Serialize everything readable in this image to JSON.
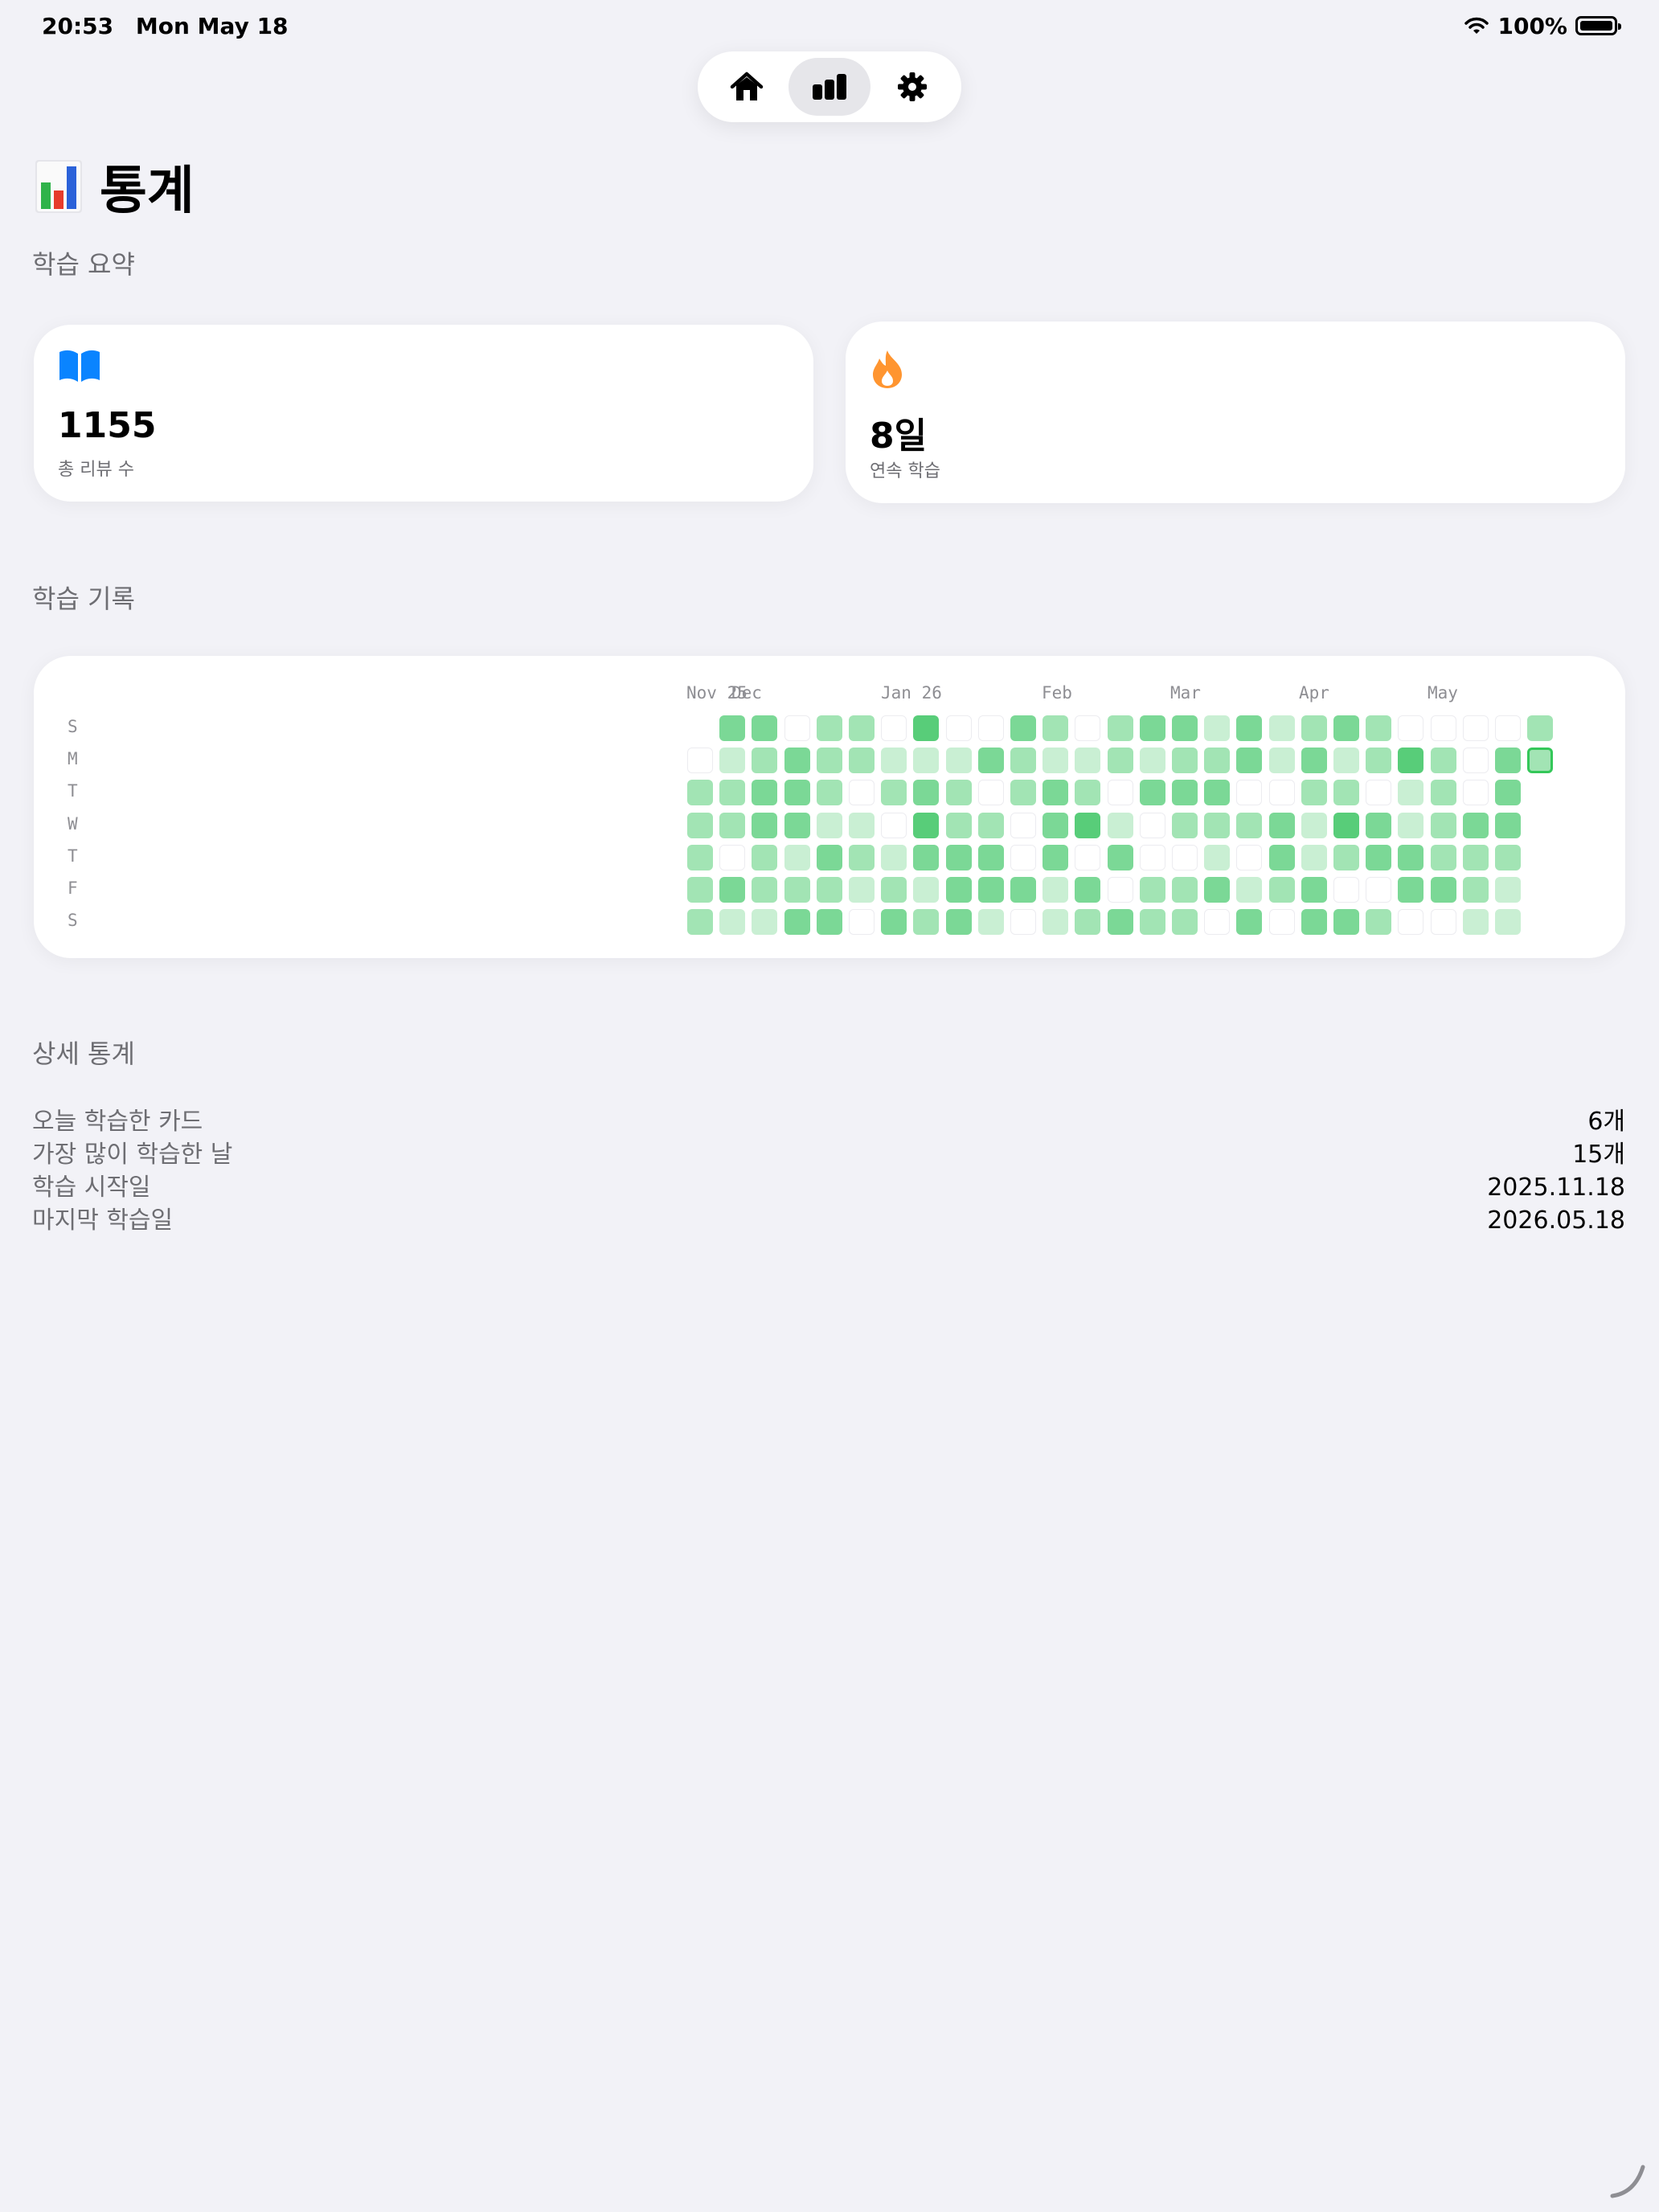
{
  "status_bar": {
    "time": "20:53",
    "date": "Mon May 18",
    "battery": "100%"
  },
  "tabs": [
    {
      "name": "home",
      "icon": "house-icon",
      "active": false
    },
    {
      "name": "stats",
      "icon": "bar-chart-icon",
      "active": true
    },
    {
      "name": "settings",
      "icon": "gear-icon",
      "active": false
    }
  ],
  "page": {
    "icon": "bar-chart-emoji",
    "title": "통계"
  },
  "summary": {
    "header": "학습 요약",
    "cards": [
      {
        "icon": "book-icon",
        "value": "1155",
        "label": "총 리뷰 수",
        "color": "#0a84ff"
      },
      {
        "icon": "flame-icon",
        "value": "8일",
        "label": "연속 학습",
        "color": "#ff9530"
      }
    ]
  },
  "history": {
    "header": "학습 기록",
    "months": [
      "Nov 25",
      "Dec",
      "Jan 26",
      "Feb",
      "Mar",
      "Apr",
      "May"
    ],
    "days": [
      "S",
      "M",
      "T",
      "W",
      "T",
      "F",
      "S"
    ],
    "level_colors": [
      "#ffffff",
      "#c9efd3",
      "#a2e4b4",
      "#7bd896",
      "#58cd79"
    ],
    "grid": [
      [
        -1,
        0,
        2,
        2,
        2,
        2,
        2
      ],
      [
        3,
        1,
        2,
        2,
        0,
        3,
        1
      ],
      [
        3,
        2,
        3,
        3,
        2,
        2,
        1
      ],
      [
        0,
        3,
        3,
        3,
        1,
        2,
        3
      ],
      [
        2,
        2,
        2,
        1,
        3,
        2,
        3
      ],
      [
        2,
        2,
        0,
        1,
        2,
        1,
        0
      ],
      [
        0,
        1,
        2,
        0,
        1,
        2,
        3
      ],
      [
        4,
        1,
        3,
        4,
        3,
        1,
        2
      ],
      [
        0,
        1,
        2,
        2,
        3,
        3,
        3
      ],
      [
        0,
        3,
        0,
        2,
        3,
        3,
        1
      ],
      [
        3,
        2,
        2,
        0,
        0,
        3,
        0
      ],
      [
        2,
        1,
        3,
        3,
        3,
        1,
        1
      ],
      [
        0,
        1,
        2,
        4,
        0,
        3,
        2
      ],
      [
        2,
        2,
        0,
        1,
        3,
        0,
        3
      ],
      [
        3,
        1,
        3,
        0,
        0,
        2,
        2
      ],
      [
        3,
        2,
        3,
        2,
        0,
        2,
        2
      ],
      [
        1,
        2,
        3,
        2,
        1,
        3,
        0
      ],
      [
        3,
        3,
        0,
        2,
        0,
        1,
        3
      ],
      [
        1,
        1,
        0,
        3,
        3,
        2,
        0
      ],
      [
        2,
        3,
        2,
        1,
        1,
        3,
        3
      ],
      [
        3,
        1,
        2,
        4,
        2,
        0,
        3
      ],
      [
        2,
        2,
        0,
        3,
        3,
        0,
        2
      ],
      [
        0,
        4,
        1,
        1,
        3,
        3,
        0
      ],
      [
        0,
        2,
        2,
        2,
        2,
        3,
        0
      ],
      [
        0,
        0,
        0,
        3,
        2,
        2,
        1
      ],
      [
        0,
        3,
        3,
        3,
        2,
        1,
        1
      ],
      [
        2,
        2,
        -1,
        -1,
        -1,
        -1,
        -1
      ]
    ]
  },
  "details": {
    "header": "상세 통계",
    "rows": [
      {
        "label": "오늘 학습한 카드",
        "value": "6개"
      },
      {
        "label": "가장 많이 학습한 날",
        "value": "15개"
      },
      {
        "label": "학습 시작일",
        "value": "2025.11.18"
      },
      {
        "label": "마지막 학습일",
        "value": "2026.05.18"
      }
    ]
  }
}
